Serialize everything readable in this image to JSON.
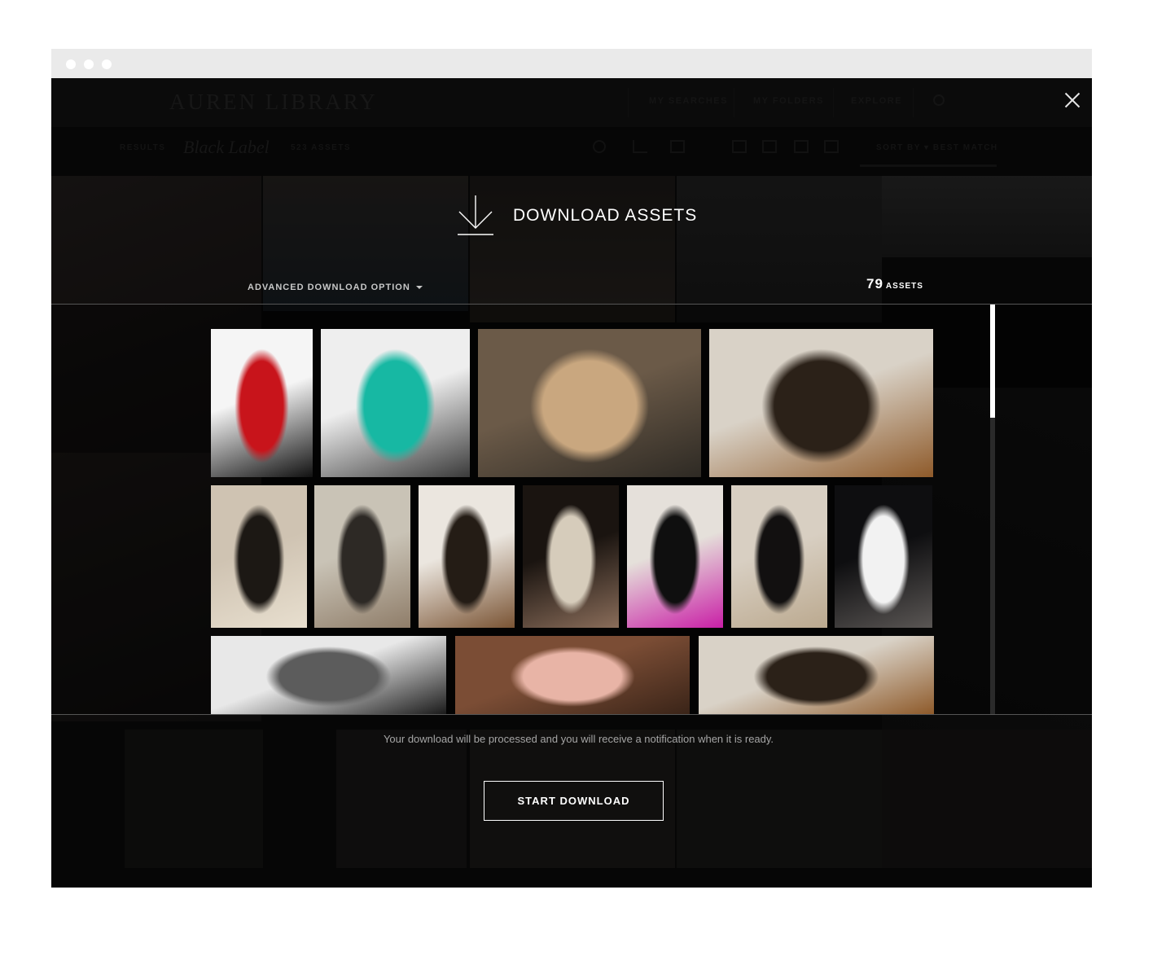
{
  "background_app": {
    "logo": "AUREN LIBRARY",
    "nav": [
      "MY SEARCHES",
      "MY FOLDERS",
      "EXPLORE"
    ],
    "breadcrumb": "RESULTS",
    "collection_title": "Black Label",
    "collection_count": "523 ASSETS",
    "sort": "SORT BY  ▾  BEST MATCH"
  },
  "modal": {
    "title": "DOWNLOAD ASSETS",
    "advanced_option": "ADVANCED DOWNLOAD OPTION",
    "asset_count": "79",
    "asset_count_label": "ASSETS",
    "notice": "Your download will be processed and you will receive a notification when it is ready.",
    "start_button": "START DOWNLOAD",
    "icons": {
      "close": "close-icon",
      "download": "download-arrow-icon",
      "dropdown": "caret-down-icon"
    },
    "thumbnails": [
      {
        "name": "red-gown-runway",
        "colors": [
          "#f5f5f5",
          "#c8141b",
          "#111111"
        ]
      },
      {
        "name": "teal-blouse-mannequin",
        "colors": [
          "#eeeeee",
          "#17b8a3",
          "#3a3a3a"
        ]
      },
      {
        "name": "crowd-greeting",
        "colors": [
          "#6b5a48",
          "#c9a77f",
          "#2e2a24"
        ]
      },
      {
        "name": "models-backstage-leopard",
        "colors": [
          "#d9d2c7",
          "#2b2118",
          "#8e5a2a"
        ]
      },
      {
        "name": "striped-coat-back",
        "colors": [
          "#cfc3b2",
          "#1c1814",
          "#e8dfcf"
        ]
      },
      {
        "name": "man-seated-runway",
        "colors": [
          "#c9c3b6",
          "#2d2925",
          "#8f7d69"
        ]
      },
      {
        "name": "ponytail-back",
        "colors": [
          "#ebe6df",
          "#241c15",
          "#7a5434"
        ]
      },
      {
        "name": "lace-shoes",
        "colors": [
          "#1a1410",
          "#d6ccbb",
          "#8a6d5a"
        ]
      },
      {
        "name": "top-hat-model",
        "colors": [
          "#e5e0da",
          "#0f0f0f",
          "#c91fa6"
        ]
      },
      {
        "name": "black-dress-backstage",
        "colors": [
          "#d8cfc2",
          "#121010",
          "#bba98f"
        ]
      },
      {
        "name": "polka-dot-runway",
        "colors": [
          "#0e0e10",
          "#f2f2f2",
          "#5a5654"
        ]
      },
      {
        "name": "studio-dress-forms",
        "colors": [
          "#e8e8e8",
          "#5c5c5c",
          "#1a1a1a"
        ]
      },
      {
        "name": "pink-feathers-portrait",
        "colors": [
          "#7b4d35",
          "#e8b4a6",
          "#3a2418"
        ]
      },
      {
        "name": "models-backstage-leopard-2",
        "colors": [
          "#d9d2c7",
          "#2b2118",
          "#8e5a2a"
        ]
      }
    ]
  }
}
